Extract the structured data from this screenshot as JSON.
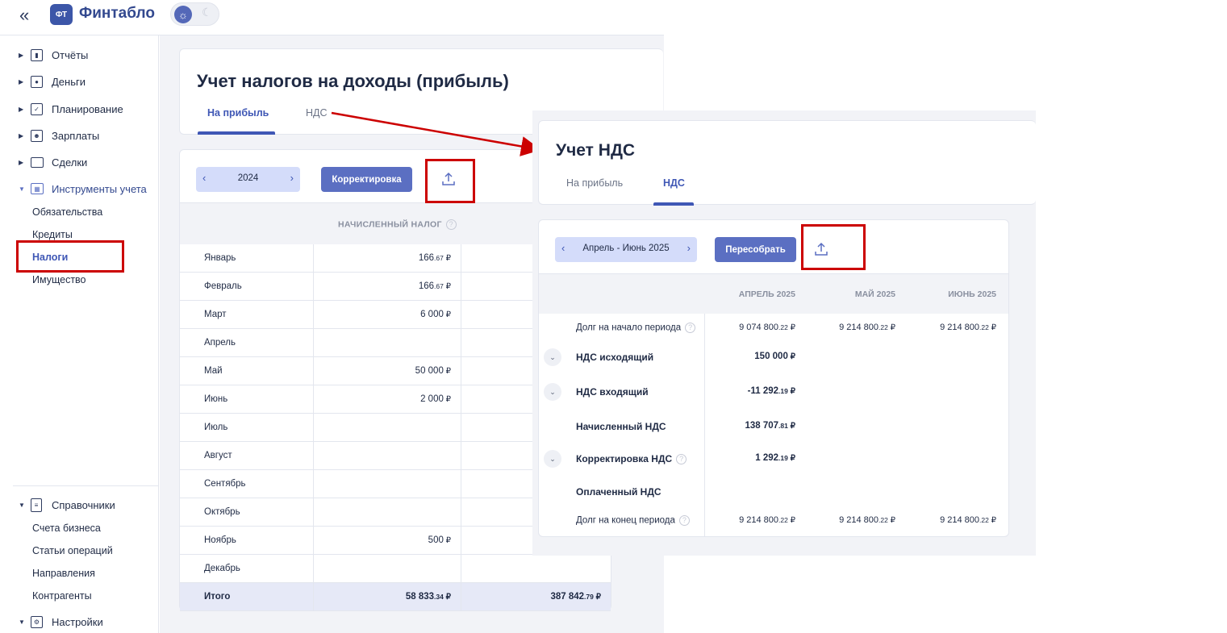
{
  "app": {
    "brand_logo": "ФТ",
    "brand_name": "Финтабло"
  },
  "sidebar": {
    "items": [
      {
        "label": "Отчёты",
        "icon": "chart-icon"
      },
      {
        "label": "Деньги",
        "icon": "wallet-icon"
      },
      {
        "label": "Планирование",
        "icon": "checklist-icon"
      },
      {
        "label": "Зарплаты",
        "icon": "person-card-icon"
      },
      {
        "label": "Сделки",
        "icon": "briefcase-icon"
      },
      {
        "label": "Инструменты учета",
        "icon": "table-icon"
      }
    ],
    "tools_sub": [
      "Обязательства",
      "Кредиты",
      "Налоги",
      "Имущество"
    ],
    "refs": {
      "label": "Справочники",
      "icon": "clipboard-icon"
    },
    "refs_sub": [
      "Счета бизнеса",
      "Статьи операций",
      "Направления",
      "Контрагенты"
    ],
    "settings": {
      "label": "Настройки",
      "icon": "gear-icon"
    }
  },
  "income_tax": {
    "title": "Учет налогов на доходы (прибыль)",
    "tabs": [
      "На прибыль",
      "НДС"
    ],
    "active_tab": "На прибыль",
    "period": "2024",
    "correction_button": "Корректировка",
    "column_header": "НАЧИСЛЕННЫЙ НАЛОГ",
    "rows": [
      {
        "month": "Январь",
        "int": "166",
        "dec": ".67",
        "cur": "₽"
      },
      {
        "month": "Февраль",
        "int": "166",
        "dec": ".67",
        "cur": "₽"
      },
      {
        "month": "Март",
        "int": "6 000",
        "dec": "",
        "cur": "₽"
      },
      {
        "month": "Апрель",
        "int": "",
        "dec": "",
        "cur": ""
      },
      {
        "month": "Май",
        "int": "50 000",
        "dec": "",
        "cur": "₽"
      },
      {
        "month": "Июнь",
        "int": "2 000",
        "dec": "",
        "cur": "₽"
      },
      {
        "month": "Июль",
        "int": "",
        "dec": "",
        "cur": ""
      },
      {
        "month": "Август",
        "int": "",
        "dec": "",
        "cur": ""
      },
      {
        "month": "Сентябрь",
        "int": "",
        "dec": "",
        "cur": ""
      },
      {
        "month": "Октябрь",
        "int": "",
        "dec": "",
        "cur": ""
      },
      {
        "month": "Ноябрь",
        "int": "500",
        "dec": "",
        "cur": "₽"
      },
      {
        "month": "Декабрь",
        "int": "",
        "dec": "",
        "cur": ""
      }
    ],
    "total": {
      "label": "Итого",
      "int": "58 833",
      "dec": ".34",
      "cur": "₽",
      "int2": "387 842",
      "dec2": ".79",
      "cur2": "₽"
    }
  },
  "vat": {
    "title": "Учет НДС",
    "tabs": [
      "На прибыль",
      "НДС"
    ],
    "active_tab": "НДС",
    "period": "Апрель - Июнь 2025",
    "rebuild_button": "Пересобрать",
    "columns": [
      "АПРЕЛЬ 2025",
      "МАЙ 2025",
      "ИЮНЬ 2025"
    ],
    "rows": [
      {
        "label": "Долг на начало периода",
        "help": true,
        "chevron": false,
        "bold": false,
        "values": [
          {
            "int": "9 074 800",
            "dec": ".22",
            "cur": "₽"
          },
          {
            "int": "9 214 800",
            "dec": ".22",
            "cur": "₽"
          },
          {
            "int": "9 214 800",
            "dec": ".22",
            "cur": "₽"
          }
        ]
      },
      {
        "label": "НДС исходящий",
        "help": false,
        "chevron": true,
        "bold": true,
        "values": [
          {
            "int": "150 000",
            "dec": "",
            "cur": "₽"
          }
        ]
      },
      {
        "label": "НДС входящий",
        "help": false,
        "chevron": true,
        "bold": true,
        "values": [
          {
            "int": "-11 292",
            "dec": ".19",
            "cur": "₽"
          }
        ]
      },
      {
        "label": "Начисленный НДС",
        "help": false,
        "chevron": false,
        "bold": true,
        "values": [
          {
            "int": "138 707",
            "dec": ".81",
            "cur": "₽"
          }
        ]
      },
      {
        "label": "Корректировка НДС",
        "help": true,
        "chevron": true,
        "bold": true,
        "values": [
          {
            "int": "1 292",
            "dec": ".19",
            "cur": "₽"
          }
        ]
      },
      {
        "label": "Оплаченный НДС",
        "help": false,
        "chevron": false,
        "bold": true,
        "values": []
      },
      {
        "label": "Долг на конец периода",
        "help": true,
        "chevron": false,
        "bold": false,
        "values": [
          {
            "int": "9 214 800",
            "dec": ".22",
            "cur": "₽"
          },
          {
            "int": "9 214 800",
            "dec": ".22",
            "cur": "₽"
          },
          {
            "int": "9 214 800",
            "dec": ".22",
            "cur": "₽"
          }
        ]
      }
    ]
  },
  "colors": {
    "accent": "#3f57b5",
    "highlight_box": "#cc0000",
    "arrow": "#cc0000"
  }
}
